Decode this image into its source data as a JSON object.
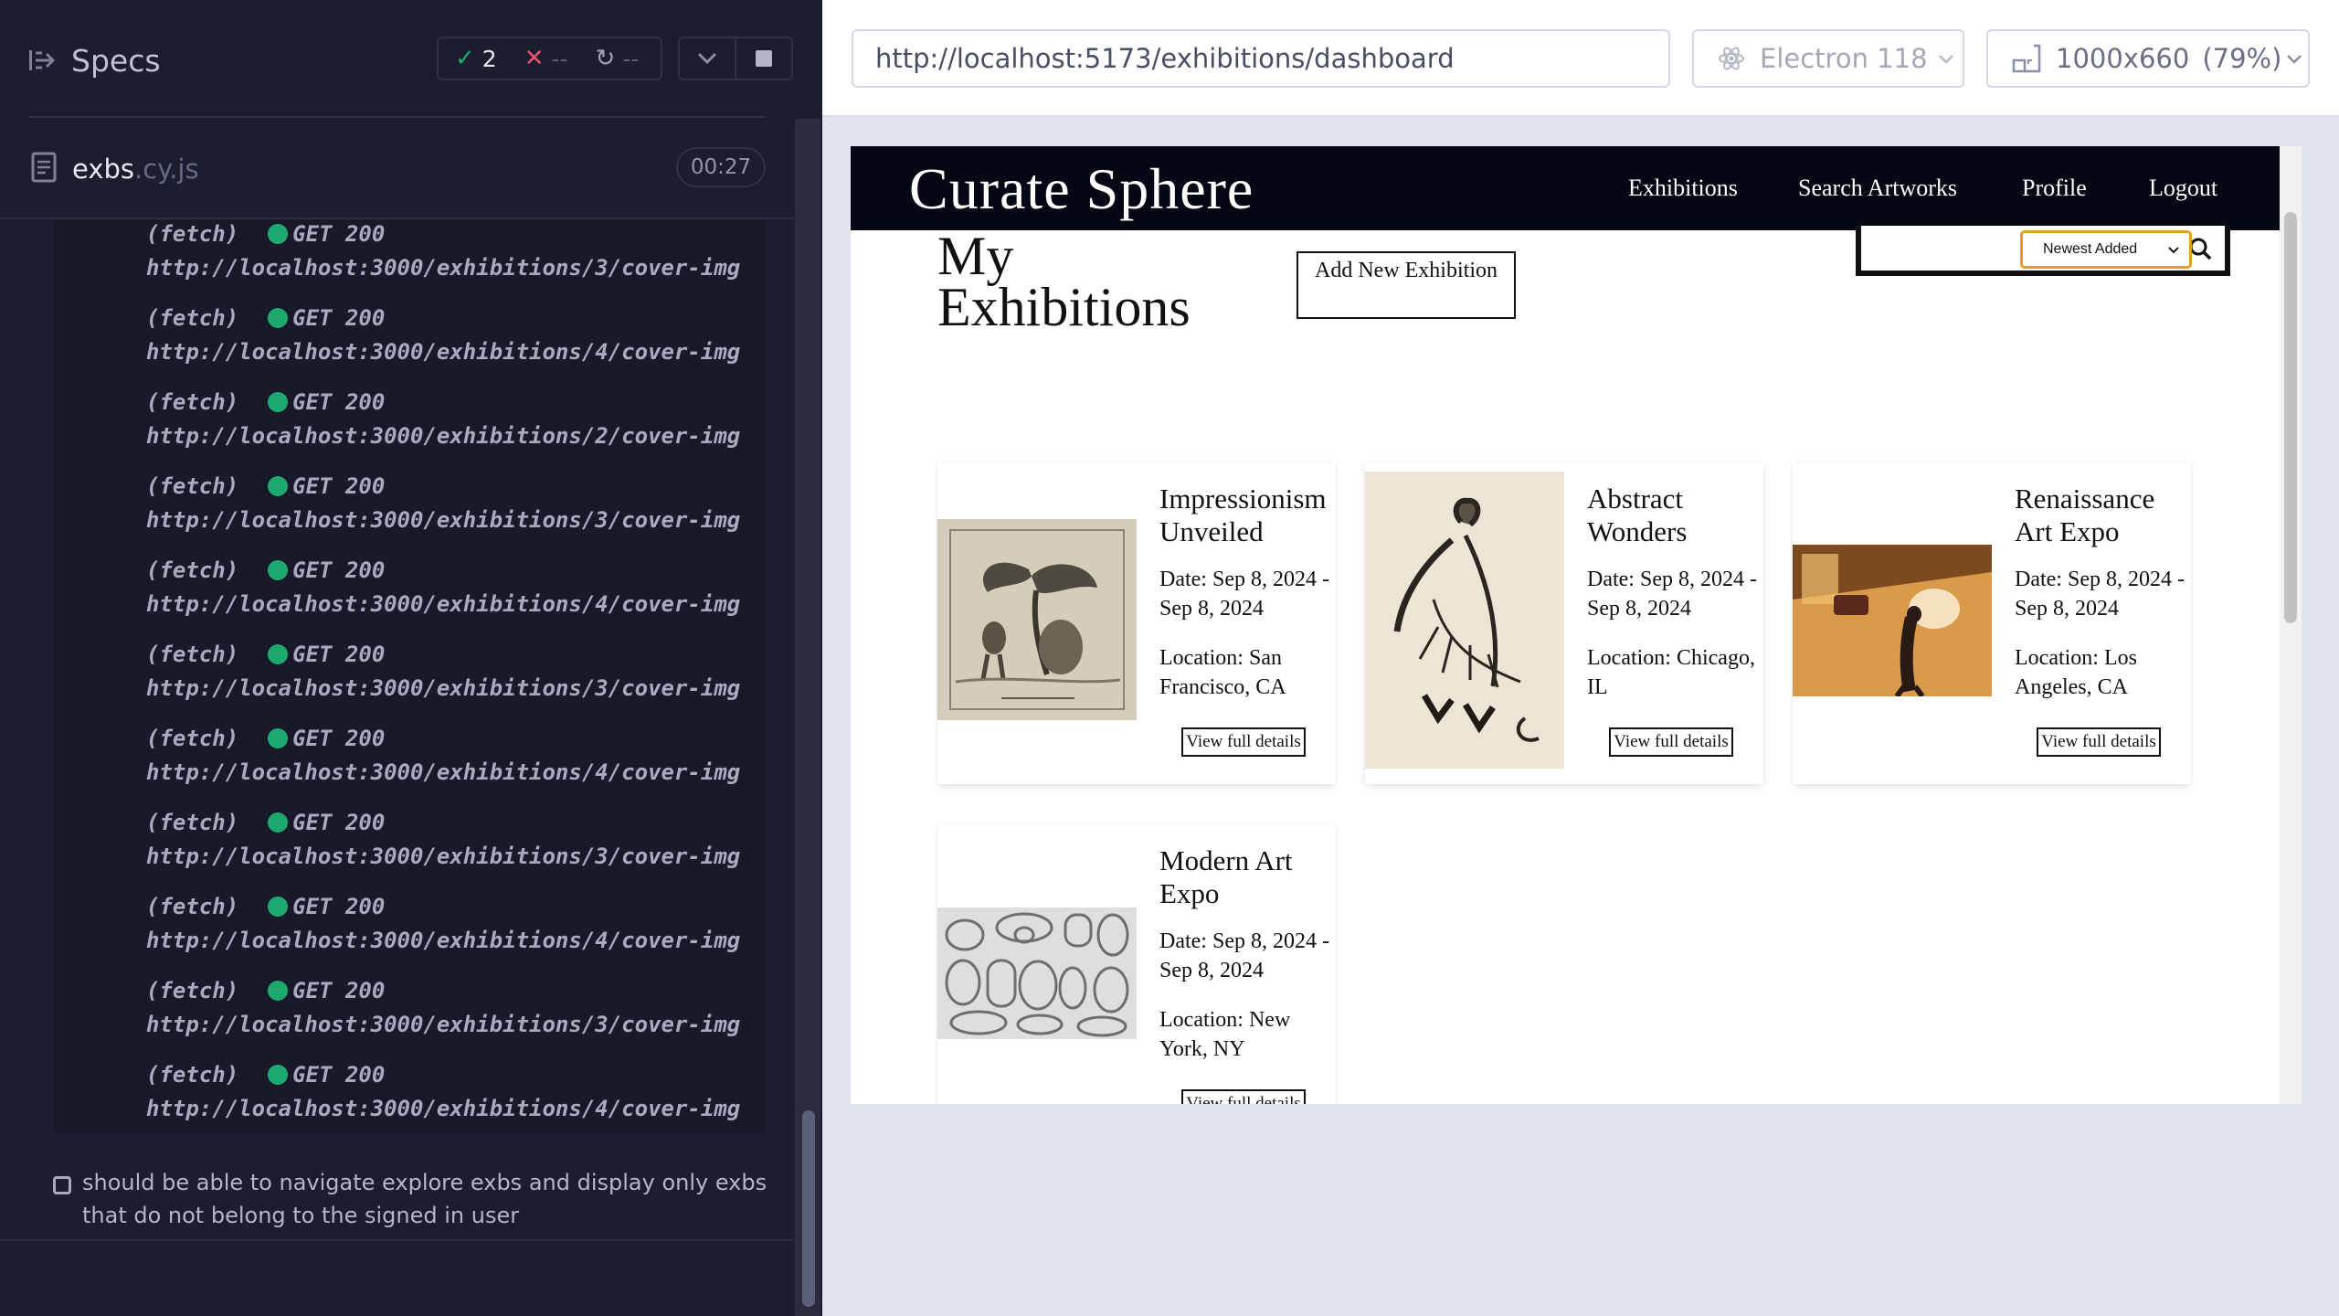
{
  "runner": {
    "specs_title": "Specs",
    "stats": {
      "passed": "2",
      "failed": "--",
      "pending": "--"
    },
    "file": {
      "name": "exbs",
      "ext": ".cy.js",
      "duration": "00:27"
    },
    "log": [
      {
        "method": "(fetch)",
        "status": "GET 200",
        "url": "http://localhost:3000/exhibitions/3/cover-img"
      },
      {
        "method": "(fetch)",
        "status": "GET 200",
        "url": "http://localhost:3000/exhibitions/4/cover-img"
      },
      {
        "method": "(fetch)",
        "status": "GET 200",
        "url": "http://localhost:3000/exhibitions/2/cover-img"
      },
      {
        "method": "(fetch)",
        "status": "GET 200",
        "url": "http://localhost:3000/exhibitions/3/cover-img"
      },
      {
        "method": "(fetch)",
        "status": "GET 200",
        "url": "http://localhost:3000/exhibitions/4/cover-img"
      },
      {
        "method": "(fetch)",
        "status": "GET 200",
        "url": "http://localhost:3000/exhibitions/3/cover-img"
      },
      {
        "method": "(fetch)",
        "status": "GET 200",
        "url": "http://localhost:3000/exhibitions/4/cover-img"
      },
      {
        "method": "(fetch)",
        "status": "GET 200",
        "url": "http://localhost:3000/exhibitions/3/cover-img"
      },
      {
        "method": "(fetch)",
        "status": "GET 200",
        "url": "http://localhost:3000/exhibitions/4/cover-img"
      },
      {
        "method": "(fetch)",
        "status": "GET 200",
        "url": "http://localhost:3000/exhibitions/3/cover-img"
      },
      {
        "method": "(fetch)",
        "status": "GET 200",
        "url": "http://localhost:3000/exhibitions/4/cover-img"
      }
    ],
    "pending_test": "should be able to navigate explore exbs and display only exbs that do not belong to the signed in user"
  },
  "browser": {
    "url": "http://localhost:5173/exhibitions/dashboard",
    "browser_name": "Electron 118",
    "viewport": "1000x660",
    "zoom": "(79%)"
  },
  "app": {
    "brand": "Curate Sphere",
    "nav": [
      "Exhibitions",
      "Search Artworks",
      "Profile",
      "Logout"
    ],
    "page_title": "My Exhibitions",
    "add_button": "Add New Exhibition",
    "search_placeholder": "",
    "sort_selected": "Newest Added",
    "cards": [
      {
        "title": "Impressionism Unveiled",
        "date": "Date: Sep 8, 2024 - Sep 8, 2024",
        "location": "Location: San Francisco, CA",
        "button": "View full details"
      },
      {
        "title": "Abstract Wonders",
        "date": "Date: Sep 8, 2024 - Sep 8, 2024",
        "location": "Location: Chicago, IL",
        "button": "View full details"
      },
      {
        "title": "Renaissance Art Expo",
        "date": "Date: Sep 8, 2024 - Sep 8, 2024",
        "location": "Location: Los Angeles, CA",
        "button": "View full details"
      },
      {
        "title": "Modern Art Expo",
        "date": "Date: Sep 8, 2024 - Sep 8, 2024",
        "location": "Location: New York, NY",
        "button": "View full details"
      }
    ]
  },
  "colors": {
    "runner_bg": "#1b1e2e",
    "pass_green": "#1fa971",
    "fail_red": "#e45770",
    "app_nav_bg": "#050714",
    "select_focus": "#e0a020"
  },
  "icons": {
    "specs": "specs-icon",
    "file": "document-icon",
    "search": "search-icon",
    "browser": "electron-icon",
    "viewport": "viewport-size-icon"
  }
}
